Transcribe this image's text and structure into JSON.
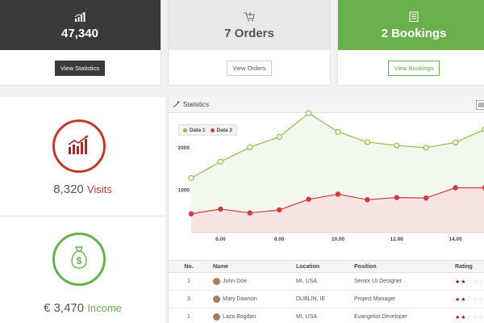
{
  "cards": [
    {
      "value": "47,340",
      "button": "View Statistics",
      "icon": "bar-chart-icon"
    },
    {
      "value": "7 Orders",
      "button": "View Orders",
      "icon": "cart-icon"
    },
    {
      "value": "2 Bookings",
      "button": "View Bookings",
      "icon": "clipboard-icon"
    }
  ],
  "visits": {
    "number": "8,320",
    "label": "Visits",
    "color": "#c0392b",
    "icon": "trend-chart-icon"
  },
  "income": {
    "number": "€ 3,470",
    "label": "Income",
    "color": "#6ab04c",
    "icon": "money-bag-icon"
  },
  "panel": {
    "title": "Statistics",
    "icon": "chart-wand-icon"
  },
  "chart_data": {
    "type": "line",
    "x": [
      5,
      6,
      7,
      8,
      9,
      10,
      11,
      12,
      13,
      14,
      15
    ],
    "x_ticks": [
      "6.00",
      "8.00",
      "10.00",
      "12.00",
      "14.00"
    ],
    "x_tick_values": [
      6,
      8,
      10,
      12,
      14
    ],
    "y_ticks": [
      "1000",
      "2000"
    ],
    "y_tick_values": [
      1000,
      2000
    ],
    "ylim": [
      0,
      2800
    ],
    "xlim": [
      5,
      15
    ],
    "series": [
      {
        "name": "Data 1",
        "color": "#8fbc45",
        "values": [
          1280,
          1660,
          2000,
          2240,
          2800,
          2360,
          2120,
          2040,
          1990,
          2110,
          2420
        ]
      },
      {
        "name": "Data 2",
        "color": "#d13b3b",
        "values": [
          440,
          550,
          460,
          530,
          780,
          900,
          770,
          820,
          810,
          1050,
          1050
        ]
      }
    ],
    "area_fill": true,
    "legend_position": "top-left"
  },
  "table": {
    "headers": [
      "No.",
      "Name",
      "Location",
      "Position",
      "Rating"
    ],
    "rows": [
      {
        "no": "1",
        "name": "John Doe",
        "location": "MI, USA",
        "position": "Senior UI Designer",
        "rating": 2
      },
      {
        "no": "3",
        "name": "Mary Dawson",
        "location": "DUBLIN, IE",
        "position": "Project Manager",
        "rating": 2
      },
      {
        "no": "1",
        "name": "Laza Bogdan",
        "location": "MI, USA",
        "position": "Evangelist Developer",
        "rating": 2
      }
    ],
    "max_rating": 5
  }
}
